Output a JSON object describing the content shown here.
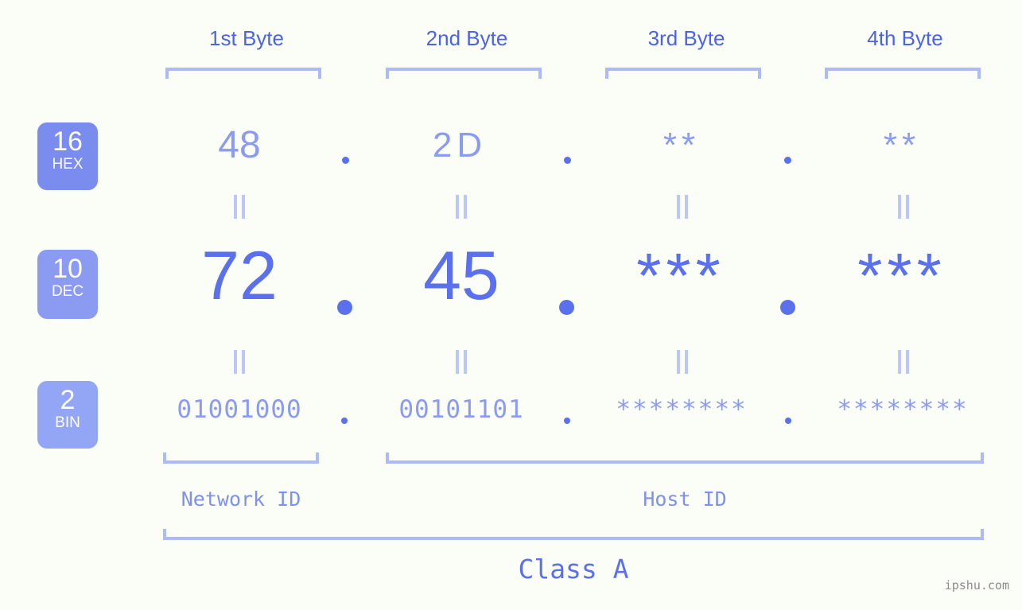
{
  "background_color": "#fbfdf7",
  "accent_colors": {
    "strong_blue": "#5a70ec",
    "mid_blue": "#8b9bf2",
    "light_blue": "#aeb9f7",
    "badge_hex": "#7b8cef",
    "badge_dec": "#8b9bf2",
    "badge_bin": "#93a6f5",
    "watermark_gray": "#8c8c8c"
  },
  "byte_headers": [
    {
      "label": "1st Byte"
    },
    {
      "label": "2nd Byte"
    },
    {
      "label": "3rd Byte"
    },
    {
      "label": "4th Byte"
    }
  ],
  "bases": [
    {
      "number": "16",
      "name": "HEX"
    },
    {
      "number": "10",
      "name": "DEC"
    },
    {
      "number": "2",
      "name": "BIN"
    }
  ],
  "rows": {
    "hex": {
      "base_number": "16",
      "base_name": "HEX",
      "values": [
        "48",
        "2D",
        "**",
        "**"
      ],
      "separator": "."
    },
    "dec": {
      "base_number": "10",
      "base_name": "DEC",
      "values": [
        "72",
        "45",
        "***",
        "***"
      ],
      "separator": "."
    },
    "bin": {
      "base_number": "2",
      "base_name": "BIN",
      "values": [
        "01001000",
        "00101101",
        "********",
        "********"
      ],
      "separator": "."
    }
  },
  "equals_marker": "=",
  "segments": {
    "network_id": "Network ID",
    "host_id": "Host ID",
    "class": "Class A"
  },
  "watermark": "ipshu.com"
}
